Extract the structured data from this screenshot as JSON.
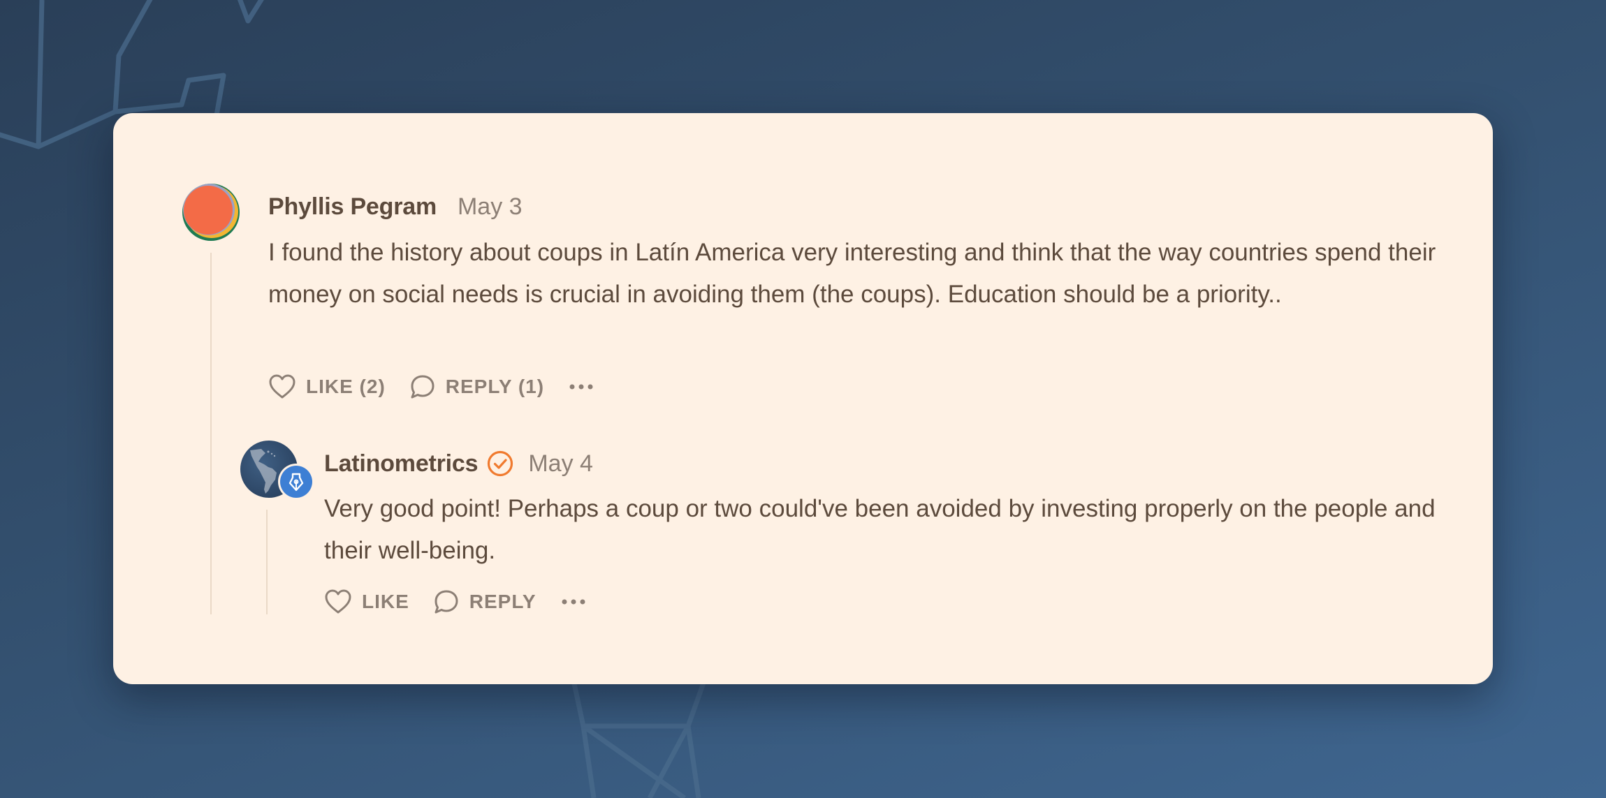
{
  "colors": {
    "card_background": "#fef1e4",
    "author_text": "#5c4a3c",
    "muted_text": "#8c7f75",
    "verified_accent": "#f07a2e",
    "badge_blue": "#3d7fd4"
  },
  "comments": [
    {
      "author": "Phyllis Pegram",
      "date": "May 3",
      "text": "I found the history about coups in Latín America very interesting and think that the way countries spend their money on social needs is crucial in avoiding them (the coups). Education should be a priority..",
      "like_label": "LIKE (2)",
      "reply_label": "REPLY (1)",
      "icons": [
        "heart-icon",
        "speech-bubble-icon",
        "more-dots-icon"
      ]
    },
    {
      "author": "Latinometrics",
      "verified": true,
      "date": "May 4",
      "text": "Very good point! Perhaps a coup or two could've been avoided by investing properly on the people and their well-being.",
      "like_label": "LIKE",
      "reply_label": "REPLY",
      "icons": [
        "verified-check-icon",
        "pen-nib-icon",
        "heart-icon",
        "speech-bubble-icon",
        "more-dots-icon"
      ]
    }
  ]
}
